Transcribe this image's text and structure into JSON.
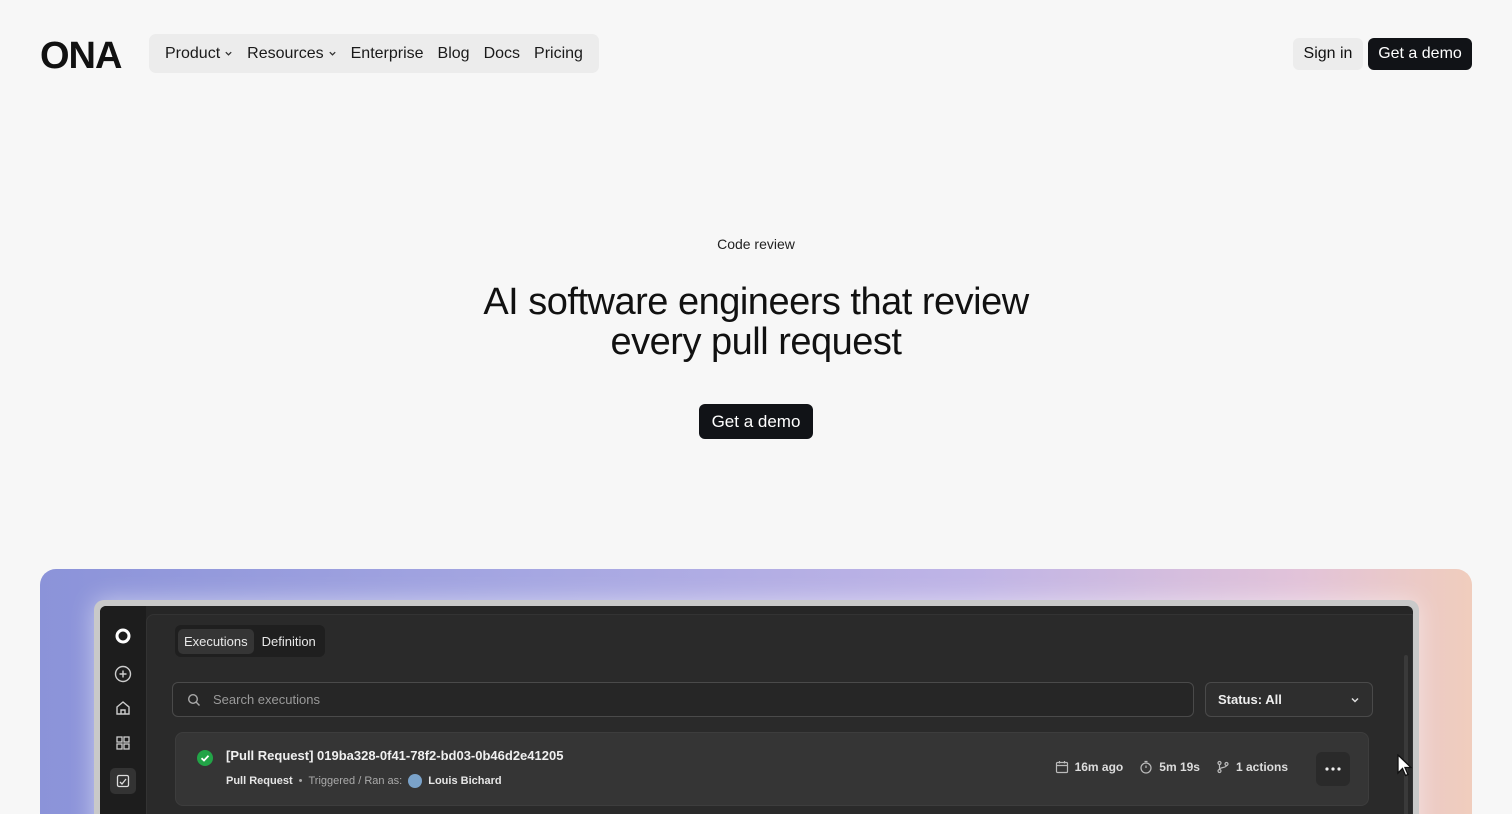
{
  "header": {
    "logo_text": "ONA",
    "nav": [
      {
        "label": "Product",
        "dropdown": true
      },
      {
        "label": "Resources",
        "dropdown": true
      },
      {
        "label": "Enterprise",
        "dropdown": false
      },
      {
        "label": "Blog",
        "dropdown": false
      },
      {
        "label": "Docs",
        "dropdown": false
      },
      {
        "label": "Pricing",
        "dropdown": false
      }
    ],
    "signin_label": "Sign in",
    "demo_label": "Get a demo"
  },
  "hero": {
    "eyebrow": "Code review",
    "headline_line1": "AI software engineers that review",
    "headline_line2": "every pull request",
    "cta_label": "Get a demo"
  },
  "app_preview": {
    "tabs": [
      "Executions",
      "Definition"
    ],
    "active_tab": "Executions",
    "search_placeholder": "Search executions",
    "status_label": "Status: All",
    "row": {
      "title": "[Pull Request] 019ba328-0f41-78f2-bd03-0b46d2e41205",
      "type": "Pull Request",
      "trigger_label": "Triggered / Ran as:",
      "user": "Louis Bichard",
      "time_ago": "16m ago",
      "duration": "5m 19s",
      "actions": "1 actions",
      "status": "success"
    },
    "rail_icons": [
      "ona-logo-icon",
      "plus-circle-icon",
      "home-icon",
      "grid-icon",
      "automation-icon"
    ]
  },
  "colors": {
    "background": "#f7f7f7",
    "primary_button": "#111317",
    "success": "#22a447"
  }
}
